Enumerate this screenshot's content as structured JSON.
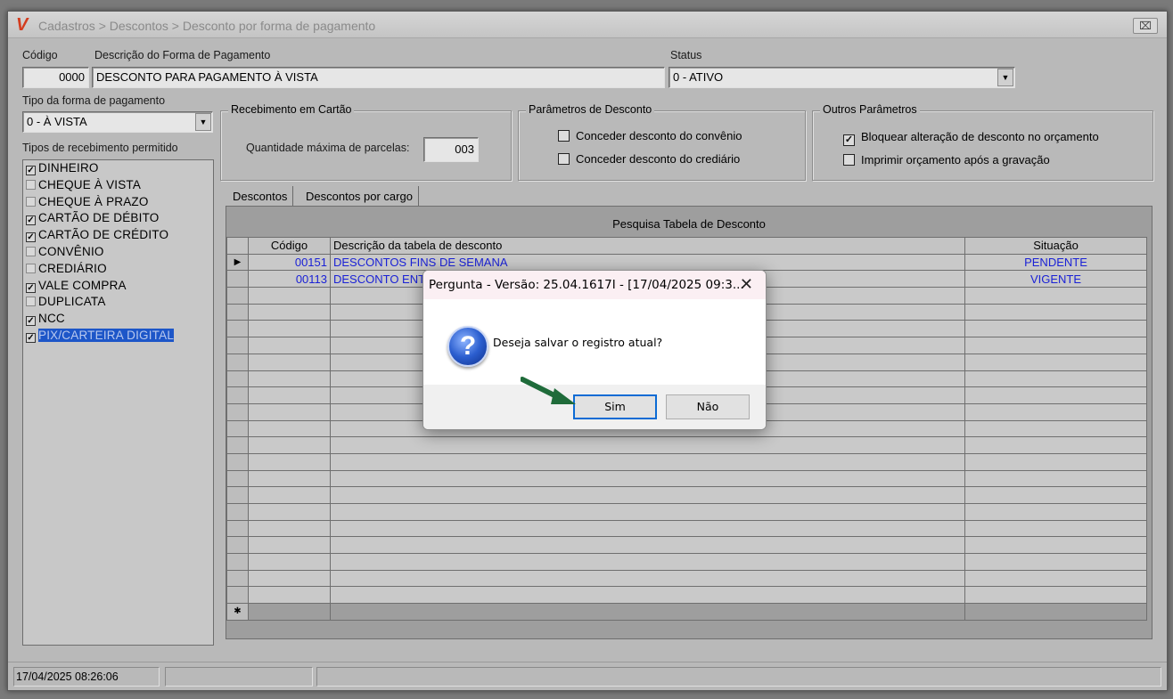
{
  "window": {
    "title": "Cadastros > Descontos > Desconto por forma de pagamento",
    "logo": "V",
    "close_glyph": "⌧"
  },
  "form": {
    "codigo_label": "Código",
    "codigo_value": "0000",
    "descricao_label": "Descrição do Forma de Pagamento",
    "descricao_value": "DESCONTO PARA PAGAMENTO À VISTA",
    "status_label": "Status",
    "status_value": "0 - ATIVO",
    "tipo_label": "Tipo da forma de pagamento",
    "tipo_value": "0 - À VISTA",
    "tipos_receb_label": "Tipos de recebimento permitido"
  },
  "recebimento_cartao": {
    "title": "Recebimento em Cartão",
    "qtd_label": "Quantidade máxima de parcelas:",
    "qtd_value": "003"
  },
  "parametros_desconto": {
    "title": "Parâmetros de Desconto",
    "options": [
      {
        "label": "Conceder desconto do convênio",
        "checked": false
      },
      {
        "label": "Conceder desconto do crediário",
        "checked": false
      }
    ]
  },
  "outros_parametros": {
    "title": "Outros Parâmetros",
    "options": [
      {
        "label": "Bloquear alteração de desconto no orçamento",
        "checked": true
      },
      {
        "label": "Imprimir orçamento após a gravação",
        "checked": false
      }
    ]
  },
  "tipos_recebimento": [
    {
      "label": "DINHEIRO",
      "checked": true
    },
    {
      "label": "CHEQUE À VISTA",
      "checked": false
    },
    {
      "label": "CHEQUE À PRAZO",
      "checked": false
    },
    {
      "label": "CARTÃO DE DÉBITO",
      "checked": true
    },
    {
      "label": "CARTÃO DE CRÉDITO",
      "checked": true
    },
    {
      "label": "CONVÊNIO",
      "checked": false
    },
    {
      "label": "CREDIÁRIO",
      "checked": false
    },
    {
      "label": "VALE COMPRA",
      "checked": true
    },
    {
      "label": "DUPLICATA",
      "checked": false
    },
    {
      "label": "NCC",
      "checked": true
    },
    {
      "label": "PIX/CARTEIRA DIGITAL",
      "checked": true,
      "selected": true
    }
  ],
  "tabs": [
    "Descontos",
    "Descontos por cargo"
  ],
  "grid": {
    "caption": "Pesquisa Tabela de Desconto",
    "columns": [
      "Código",
      "Descrição da tabela de desconto",
      "Situação"
    ],
    "rows": [
      {
        "codigo": "00151",
        "descricao": "DESCONTOS FINS DE SEMANA",
        "situacao": "PENDENTE"
      },
      {
        "codigo": "00113",
        "descricao": "DESCONTO ENTRE",
        "situacao": "VIGENTE"
      }
    ],
    "current_row_glyph": "▶",
    "new_row_glyph": "✱"
  },
  "statusbar": {
    "datetime": "17/04/2025 08:26:06"
  },
  "dialog": {
    "title": "Pergunta - Versão: 25.04.1617I - [17/04/2025 09:3...",
    "close_glyph": "✕",
    "icon_glyph": "?",
    "message": "Deseja salvar o registro atual?",
    "yes_label": "Sim",
    "no_label": "Não"
  },
  "annotation": {
    "arrow_color": "#1f6b3a"
  }
}
